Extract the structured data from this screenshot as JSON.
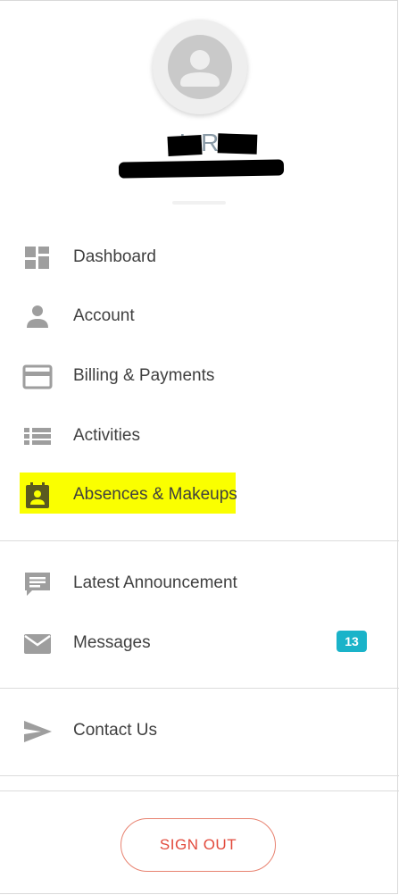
{
  "profile": {
    "name": "L R",
    "avatar_icon": "user-avatar-icon"
  },
  "menu": {
    "primary": [
      {
        "label": "Dashboard",
        "icon": "dashboard-icon"
      },
      {
        "label": "Account",
        "icon": "person-icon"
      },
      {
        "label": "Billing & Payments",
        "icon": "credit-card-icon"
      },
      {
        "label": "Activities",
        "icon": "list-icon"
      },
      {
        "label": "Absences & Makeups",
        "icon": "calendar-person-icon",
        "highlighted": true
      }
    ],
    "secondary": [
      {
        "label": "Latest Announcement",
        "icon": "announcement-icon"
      },
      {
        "label": "Messages",
        "icon": "mail-icon",
        "badge": "13"
      }
    ],
    "tertiary": [
      {
        "label": "Contact Us",
        "icon": "send-icon"
      }
    ]
  },
  "actions": {
    "sign_out": "SIGN OUT"
  },
  "colors": {
    "badge": "#1ab3c9",
    "sign_out": "#e24a3c",
    "highlight": "#faff00",
    "icon": "#9e9e9e"
  }
}
